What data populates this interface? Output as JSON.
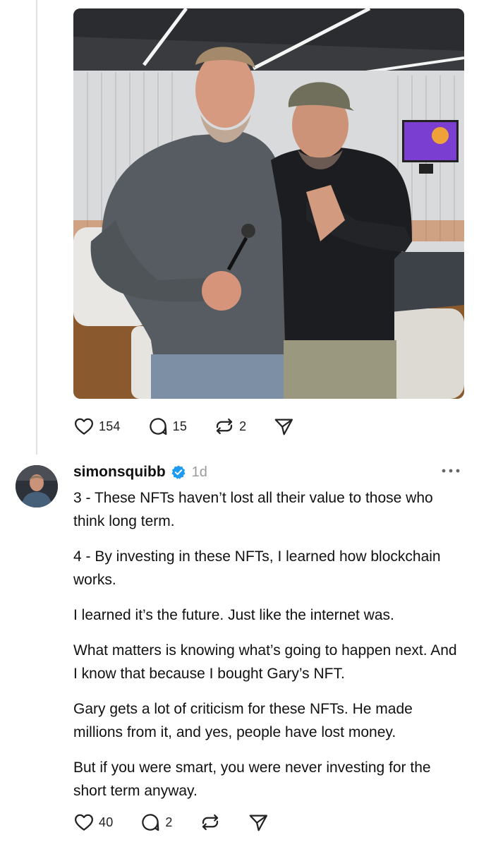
{
  "post1": {
    "image_alt": "Two men standing together in an office",
    "likes": "154",
    "replies": "15",
    "reposts": "2"
  },
  "post2": {
    "username": "simonsquibb",
    "time": "1d",
    "paragraphs": [
      "3 - These NFTs haven’t lost all their value to those who think long term.",
      "4 - By investing in these NFTs, I learned how blockchain works.",
      "I learned it’s the future. Just like the internet was.",
      "What matters is knowing what’s going to happen next. And I know that because I bought Gary’s NFT.",
      "Gary gets a lot of criticism for these NFTs. He made millions from it, and yes, people have lost money.",
      "But if you were smart, you were never investing for the short term anyway."
    ],
    "likes": "40",
    "replies": "2"
  },
  "icons": {
    "like": "heart-icon",
    "reply": "comment-icon",
    "repost": "repost-icon",
    "share": "send-icon",
    "verified": "verified-badge-icon",
    "more": "more-options-icon"
  },
  "colors": {
    "verified": "#1d9bf0",
    "muted": "#9a9a9a",
    "thread_line": "#e2e2e2"
  }
}
